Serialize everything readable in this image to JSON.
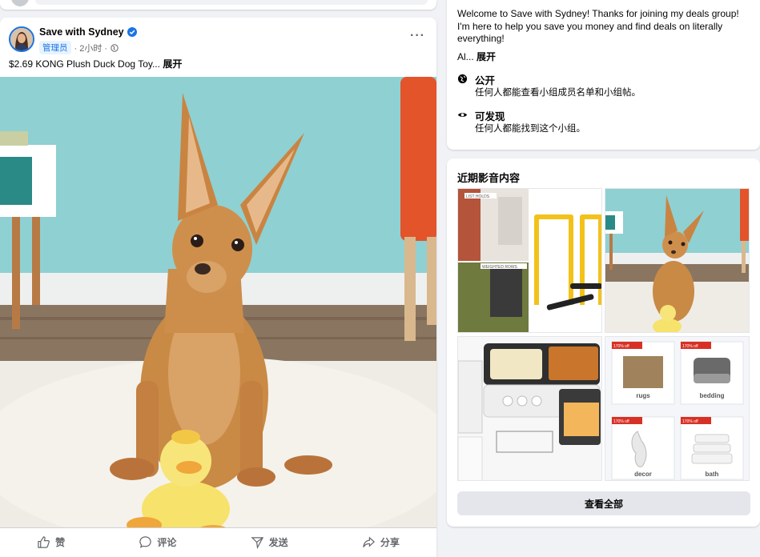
{
  "post": {
    "author": "Save with Sydney",
    "role_badge": "管理员",
    "time": "· 2小时 ·",
    "text": "$2.69 KONG Plush Duck Dog Toy...",
    "expand": "展开",
    "more": "···",
    "actions": [
      {
        "label": "赞",
        "icon": "like-icon"
      },
      {
        "label": "评论",
        "icon": "comment-icon"
      },
      {
        "label": "发送",
        "icon": "send-icon"
      },
      {
        "label": "分享",
        "icon": "share-icon"
      }
    ]
  },
  "about": {
    "description": "Welcome to Save with Sydney! Thanks for joining my deals group! I'm here to help you save you money and find deals on literally everything!",
    "truncated": "Al...",
    "expand": "展开",
    "public_title": "公开",
    "public_desc": "任何人都能查看小组成员名单和小组帖。",
    "visible_title": "可发现",
    "visible_desc": "任何人都能找到这个小组。"
  },
  "media": {
    "title": "近期影音内容",
    "see_all": "查看全部",
    "thumb1_labels": [
      "LIST HOLDS",
      "WEIGHTED ROWS"
    ],
    "sale_tag": "170% off",
    "thumb4_labels": [
      "rugs",
      "bedding",
      "decor",
      "bath"
    ]
  },
  "colors": {
    "accent": "#1b74e4",
    "secondary_text": "#65676b",
    "wall": "#8fd0d2",
    "chair": "#e3542b"
  }
}
